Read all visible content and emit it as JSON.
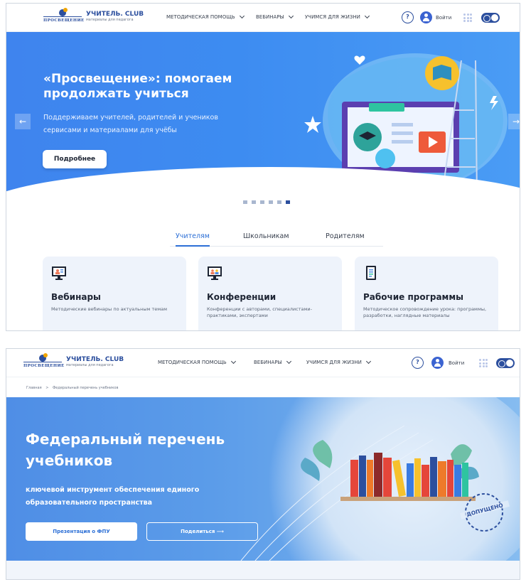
{
  "header": {
    "logo_word": "ПРОСВЕЩЕНИЕ",
    "brand_title": "УЧИТЕЛЬ. CLUB",
    "brand_subtitle": "материалы для педагога",
    "nav": [
      "МЕТОДИЧЕСКАЯ ПОМОЩЬ",
      "ВЕБИНАРЫ",
      "УЧИМСЯ ДЛЯ ЖИЗНИ"
    ],
    "help": "?",
    "login": "Войти",
    "icons": [
      "help-icon",
      "user-icon",
      "apps-grid-icon",
      "theme-toggle-icon",
      "chevron-down-icon"
    ]
  },
  "screen1": {
    "hero": {
      "title": "«Просвещение»: помогаем продолжать учиться",
      "subtitle": "Поддерживаем учителей, родителей и учеников сервисами и материалами для учёбы",
      "button": "Подробнее",
      "prev": "←",
      "next": "→"
    },
    "slider": {
      "count": 6,
      "active_index": 6
    },
    "tabs": [
      "Учителям",
      "Школьникам",
      "Родителям"
    ],
    "active_tab": "Учителям",
    "cards": [
      {
        "title": "Вебинары",
        "desc": "Методические вебинары по актуальным темам",
        "icon": "webinar-icon"
      },
      {
        "title": "Конференции",
        "desc": "Конференции с авторами, специалистами-практиками, экспертами",
        "icon": "conference-icon"
      },
      {
        "title": "Рабочие программы",
        "desc": "Методическое сопровождение урока: программы, разработки, наглядные материалы",
        "icon": "program-doc-icon"
      }
    ]
  },
  "screen2": {
    "breadcrumb": {
      "home": "Главная",
      "sep": ">",
      "current": "Федеральный перечень учебников"
    },
    "hero": {
      "title": "Федеральный перечень учебников",
      "subtitle": "ключевой инструмент обеспечения единого образовательного пространства",
      "button_primary": "Презентация о ФПУ",
      "button_secondary": "Поделиться ⟶",
      "stamp": "ДОПУЩЕНО"
    }
  },
  "colors": {
    "brand": "#2c4f9e",
    "hero1": "#3f84ee",
    "hero2": "#5b9ce9",
    "accent": "#2c6fd6"
  }
}
